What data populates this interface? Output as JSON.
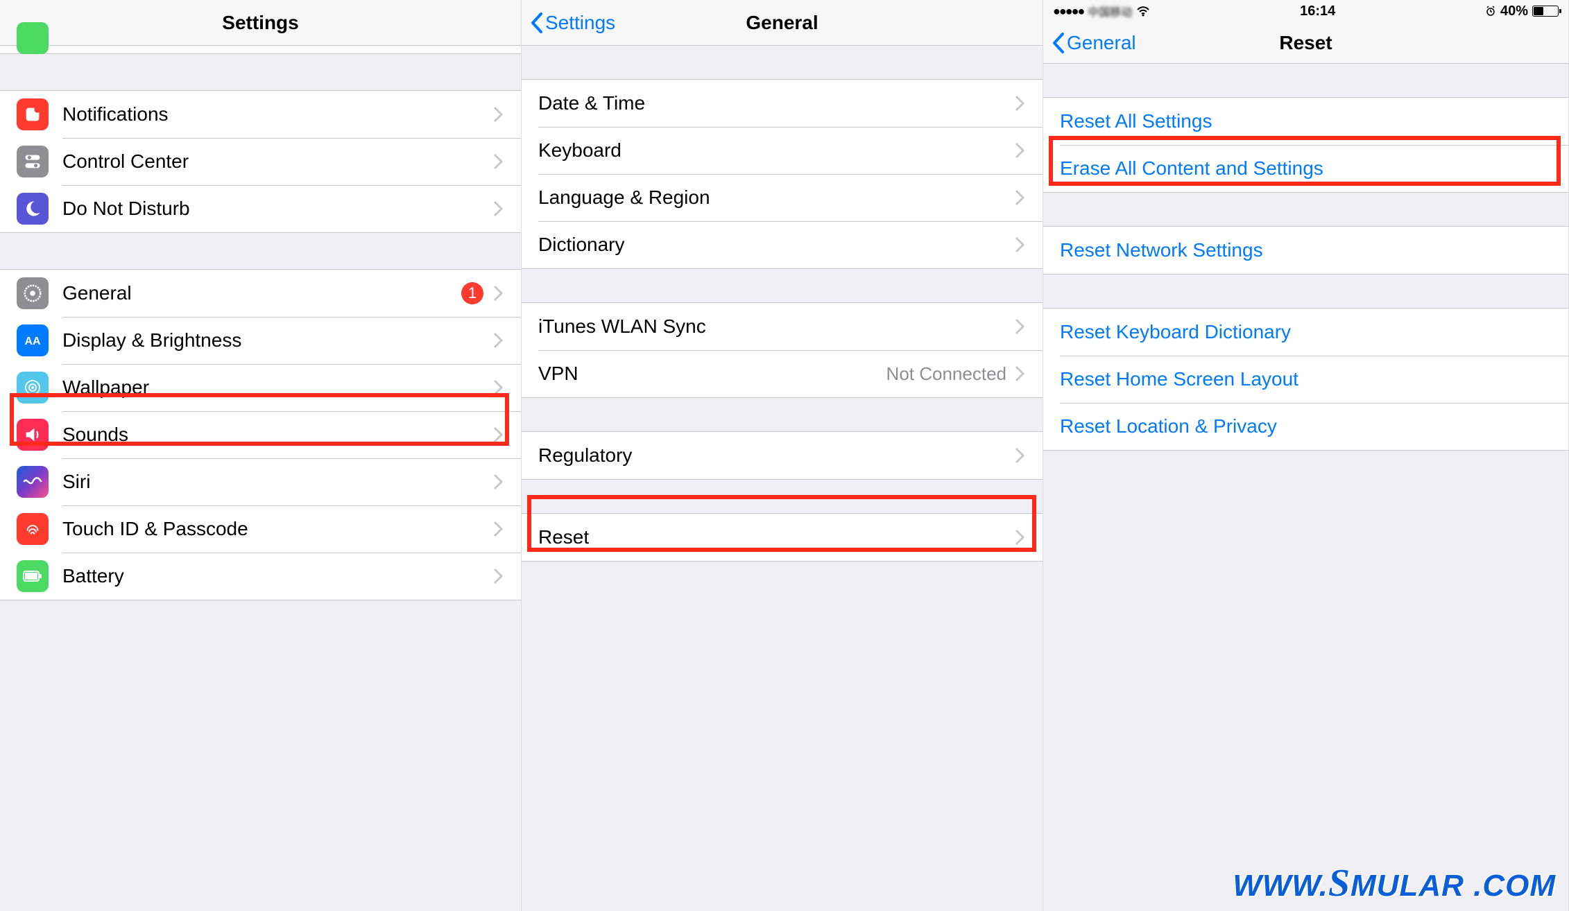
{
  "panel1": {
    "title": "Settings",
    "items": [
      {
        "label": "Notifications",
        "icon": "notifications-icon",
        "color": "#ff3b30"
      },
      {
        "label": "Control Center",
        "icon": "control-center-icon",
        "color": "#8e8e93"
      },
      {
        "label": "Do Not Disturb",
        "icon": "dnd-icon",
        "color": "#5856d6"
      }
    ],
    "items2": [
      {
        "label": "General",
        "icon": "gear-icon",
        "color": "#8e8e93",
        "badge": "1"
      },
      {
        "label": "Display & Brightness",
        "icon": "display-icon",
        "color": "#007aff"
      },
      {
        "label": "Wallpaper",
        "icon": "wallpaper-icon",
        "color": "#54c7ec"
      },
      {
        "label": "Sounds",
        "icon": "sounds-icon",
        "color": "#ff2d55"
      },
      {
        "label": "Siri",
        "icon": "siri-icon",
        "color": "gradient"
      },
      {
        "label": "Touch ID & Passcode",
        "icon": "touchid-icon",
        "color": "#ff3b30"
      },
      {
        "label": "Battery",
        "icon": "battery-icon",
        "color": "#4cd964"
      }
    ]
  },
  "panel2": {
    "back": "Settings",
    "title": "General",
    "g1": [
      {
        "label": "Date & Time"
      },
      {
        "label": "Keyboard"
      },
      {
        "label": "Language & Region"
      },
      {
        "label": "Dictionary"
      }
    ],
    "g2": [
      {
        "label": "iTunes WLAN Sync"
      },
      {
        "label": "VPN",
        "detail": "Not Connected"
      }
    ],
    "g3": [
      {
        "label": "Regulatory"
      }
    ],
    "g4": [
      {
        "label": "Reset"
      }
    ]
  },
  "panel3": {
    "status": {
      "time": "16:14",
      "battery_pct": "40%"
    },
    "back": "General",
    "title": "Reset",
    "g1": [
      {
        "label": "Reset All Settings"
      },
      {
        "label": "Erase All Content and Settings"
      }
    ],
    "g2": [
      {
        "label": "Reset Network Settings"
      }
    ],
    "g3": [
      {
        "label": "Reset Keyboard Dictionary"
      },
      {
        "label": "Reset Home Screen Layout"
      },
      {
        "label": "Reset Location & Privacy"
      }
    ]
  },
  "watermark": "www.Smular.com"
}
